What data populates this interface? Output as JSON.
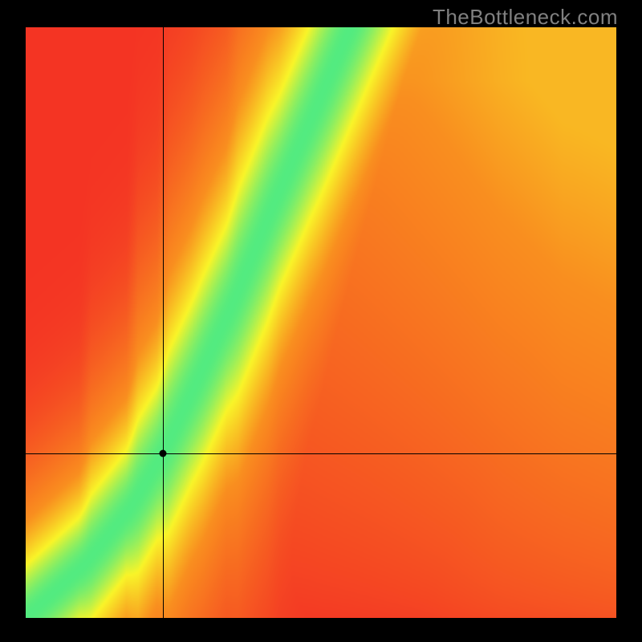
{
  "watermark": "TheBottleneck.com",
  "chart_data": {
    "type": "heatmap",
    "title": "",
    "xlabel": "",
    "ylabel": "",
    "xlim": [
      0,
      1
    ],
    "ylim": [
      0,
      1
    ],
    "grid": false,
    "legend": false,
    "crosshair": {
      "x": 0.232,
      "y": 0.278
    },
    "ridge_path": [
      {
        "x": 0.0,
        "y": 0.0
      },
      {
        "x": 0.1,
        "y": 0.09
      },
      {
        "x": 0.18,
        "y": 0.19
      },
      {
        "x": 0.232,
        "y": 0.278
      },
      {
        "x": 0.29,
        "y": 0.4
      },
      {
        "x": 0.35,
        "y": 0.53
      },
      {
        "x": 0.42,
        "y": 0.7
      },
      {
        "x": 0.49,
        "y": 0.86
      },
      {
        "x": 0.55,
        "y": 1.0
      }
    ],
    "ridge_width_sigma": 0.045,
    "background_high": {
      "x": 1.0,
      "y": 1.0,
      "value": 0.45
    },
    "background_low_left": {
      "x": 0.0,
      "y": 0.85,
      "value": 0.0
    },
    "background_low_bottom": {
      "x": 0.85,
      "y": 0.0,
      "value": 0.0
    },
    "colormap": "red-orange-yellow-green",
    "colors": {
      "red": "#f43424",
      "orange": "#fa8f1f",
      "yellow": "#f9f529",
      "green": "#17e8a0"
    }
  }
}
